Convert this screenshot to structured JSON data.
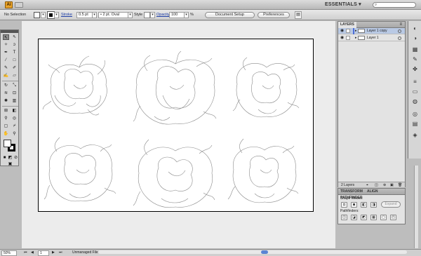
{
  "app": {
    "logo_text": "Ai",
    "workspace_label": "ESSENTIALS ▾"
  },
  "control_bar": {
    "selection_label": "No Selection",
    "stroke_label": "Stroke",
    "stroke_weight": "0.5 pt",
    "brush_value": "2 pt. Oval",
    "style_label": "Style",
    "opacity_label": "Opacity",
    "opacity_value": "100",
    "opacity_unit": "%",
    "document_setup_label": "Document Setup",
    "preferences_label": "Preferences"
  },
  "tools": [
    "selection-tool",
    "direct-selection-tool",
    "magic-wand-tool",
    "lasso-tool",
    "pen-tool",
    "type-tool",
    "line-tool",
    "rectangle-tool",
    "paintbrush-tool",
    "pencil-tool",
    "blob-brush-tool",
    "eraser-tool",
    "rotate-tool",
    "scale-tool",
    "warp-tool",
    "free-transform-tool",
    "symbol-sprayer-tool",
    "column-graph-tool",
    "mesh-tool",
    "gradient-tool",
    "eyedropper-tool",
    "blend-tool",
    "live-paint-tool",
    "live-paint-select-tool",
    "artboard-tool",
    "slice-tool",
    "hand-tool",
    "zoom-tool"
  ],
  "layers_panel": {
    "tab_label": "LAYERS",
    "layers": [
      {
        "name": "Layer 1 copy",
        "selected": true,
        "color": "#4f6fd8"
      },
      {
        "name": "Layer 1",
        "selected": false,
        "color": "#ffffff"
      }
    ],
    "footer_count": "2 Layers"
  },
  "pathfinder_panel": {
    "tabs": [
      "TRANSFORM",
      "ALIGN",
      "PATHFINDER"
    ],
    "shape_modes_label": "Shape Modes:",
    "pathfinders_label": "Pathfinders:",
    "expand_label": "Expand"
  },
  "status_bar": {
    "zoom": "50%",
    "page_number": "1",
    "file_status": "Unmanaged File"
  },
  "right_dock_icons": [
    "color-icon",
    "color-guide-icon",
    "swatches-icon",
    "brushes-icon",
    "symbols-icon",
    "stroke-icon",
    "gradient-icon",
    "transparency-icon",
    "appearance-icon",
    "graphic-styles-icon",
    "layers-icon"
  ],
  "colors": {
    "accent": "#4f6fd8",
    "selection_row": "#b9c9e4"
  }
}
